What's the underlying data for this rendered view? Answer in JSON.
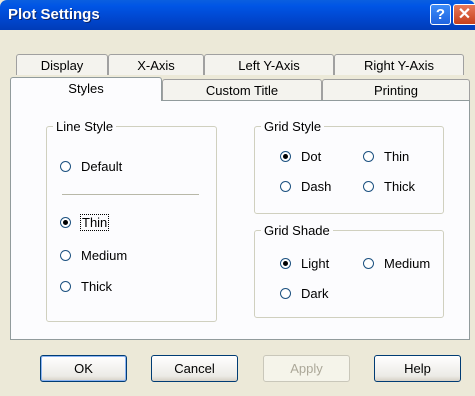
{
  "window": {
    "title": "Plot Settings",
    "help_glyph": "?",
    "close_glyph": "✕"
  },
  "tabs": {
    "row_top": [
      "Display",
      "X-Axis",
      "Left Y-Axis",
      "Right Y-Axis"
    ],
    "row_bottom": [
      "Styles",
      "Custom Title",
      "Printing"
    ],
    "active": "Styles"
  },
  "line_style": {
    "legend": "Line Style",
    "options": [
      "Default",
      "Thin",
      "Medium",
      "Thick"
    ],
    "selected": "Thin"
  },
  "grid_style": {
    "legend": "Grid Style",
    "options": [
      "Dot",
      "Thin",
      "Dash",
      "Thick"
    ],
    "selected": "Dot"
  },
  "grid_shade": {
    "legend": "Grid Shade",
    "options": [
      "Light",
      "Medium",
      "Dark"
    ],
    "selected": "Light"
  },
  "buttons": {
    "ok": "OK",
    "cancel": "Cancel",
    "apply": "Apply",
    "help": "Help"
  }
}
